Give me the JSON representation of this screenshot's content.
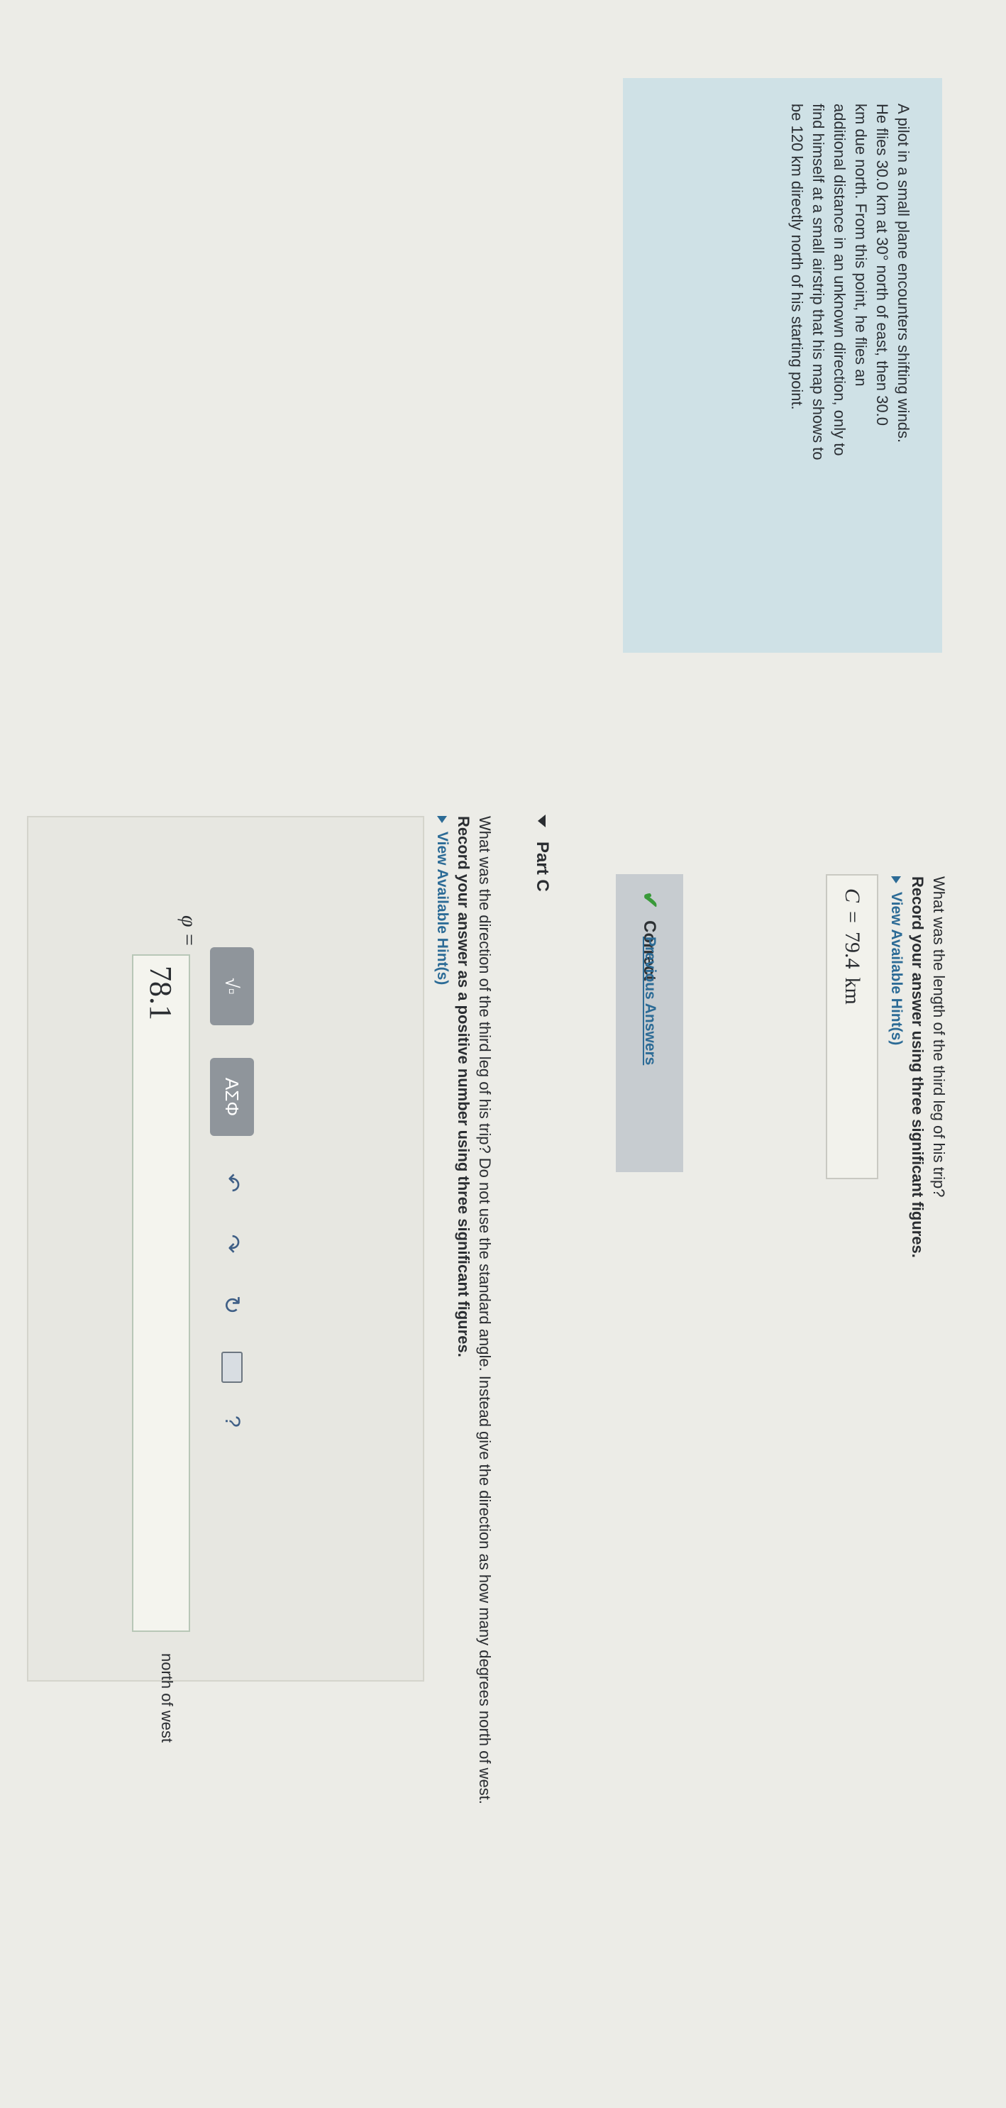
{
  "problem": {
    "lines": [
      "A pilot in a small plane encounters shifting winds.",
      "He flies 30.0 km at 30° north of east, then 30.0",
      "km due north. From this point, he flies an",
      "additional distance in an unknown direction, only to",
      "find himself at a small airstrip that his map shows to",
      "be 120 km directly north of his starting point."
    ]
  },
  "part_b": {
    "question": "What was the length of the third leg of his trip?",
    "instruction": "Record your answer using three significant figures.",
    "hint_link": "View Available Hint(s)",
    "variable": "C",
    "equals": "=",
    "value": "79.4",
    "unit": "km",
    "status": "Correct",
    "previous_answers": "Previous Answers"
  },
  "part_c": {
    "label": "Part C",
    "question": "What was the direction of the third leg of his trip? Do not use the standard angle. Instead give the direction as how many degrees north of west.",
    "instruction": "Record your answer as a positive number using three significant figures.",
    "hint_link": "View Available Hint(s)",
    "variable": "φ =",
    "input_value": "78.1",
    "unit": "north of west",
    "toolbar": {
      "math_button": "√▫",
      "greek_button": "ΑΣΦ",
      "icons": [
        "undo-icon",
        "redo-icon",
        "reset-icon",
        "keyboard-icon",
        "help-icon"
      ],
      "help": "?"
    }
  },
  "colors": {
    "problem_bg": "#cfe1e6",
    "link": "#2c6b96",
    "correct_check": "#3a9a3a",
    "toolbar_button": "#8f959b"
  }
}
